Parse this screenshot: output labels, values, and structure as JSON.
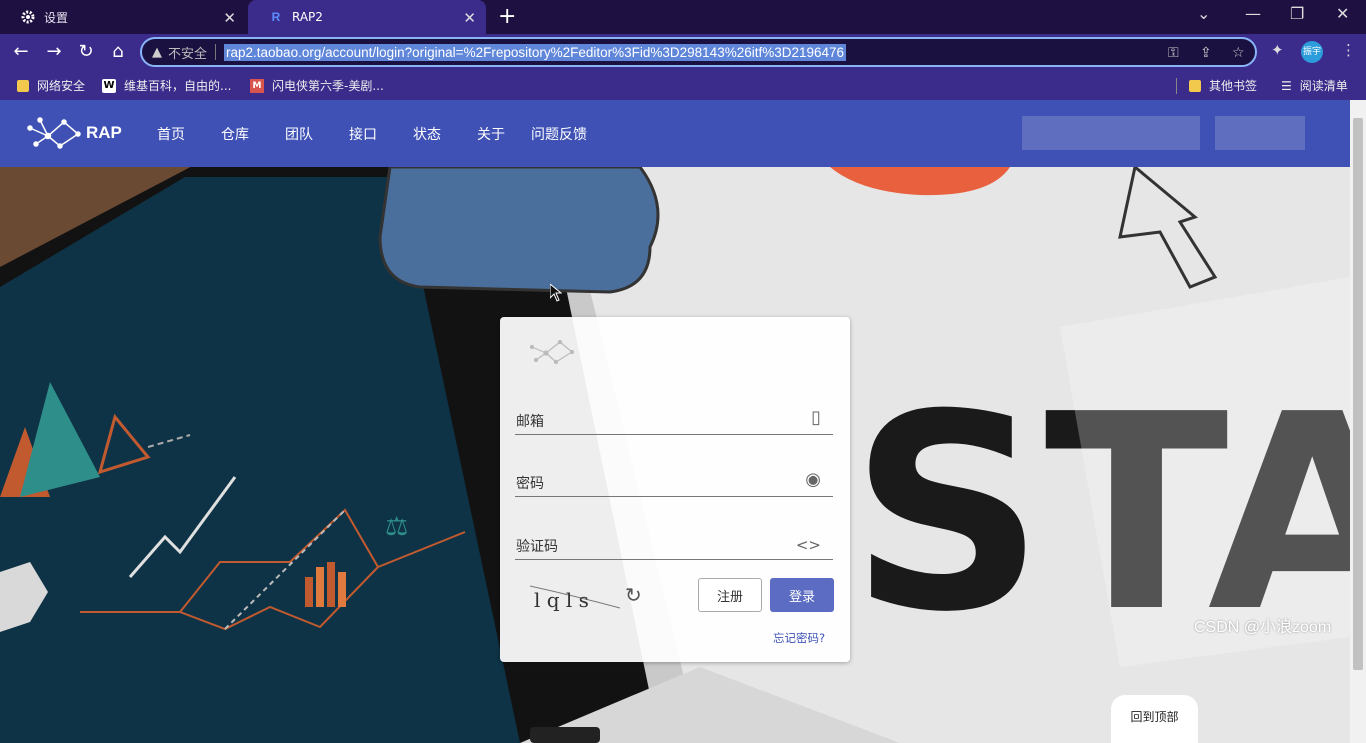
{
  "browser": {
    "tabs": [
      {
        "title": "设置",
        "icon": "gear-icon"
      },
      {
        "title": "RAP2",
        "icon": "rap-favicon"
      }
    ],
    "security_label": "不安全",
    "url": "rap2.taobao.org/account/login?original=%2Frepository%2Feditor%3Fid%3D298143%26itf%3D2196476",
    "profile_label": "振宇",
    "bookmarks": [
      "网络安全",
      "维基百科，自由的...",
      "闪电侠第六季-美剧..."
    ],
    "bookmarks_right": [
      "其他书签",
      "阅读清单"
    ]
  },
  "app": {
    "logo_text": "RAP",
    "nav": [
      "首页",
      "仓库",
      "团队",
      "接口",
      "状态",
      "关于",
      "问题反馈"
    ]
  },
  "login": {
    "email_label": "邮箱",
    "password_label": "密码",
    "captcha_label": "验证码",
    "captcha_text": "l q l s",
    "register_label": "注册",
    "login_label": "登录",
    "forgot_label": "忘记密码?"
  },
  "back_to_top": "回到顶部",
  "watermark": "CSDN @小浪zoom",
  "colors": {
    "tab_bar": "#1f1042",
    "toolbar": "#3b2c8c",
    "app_nav": "#3f51b5",
    "primary_button": "#5b6cc2"
  }
}
